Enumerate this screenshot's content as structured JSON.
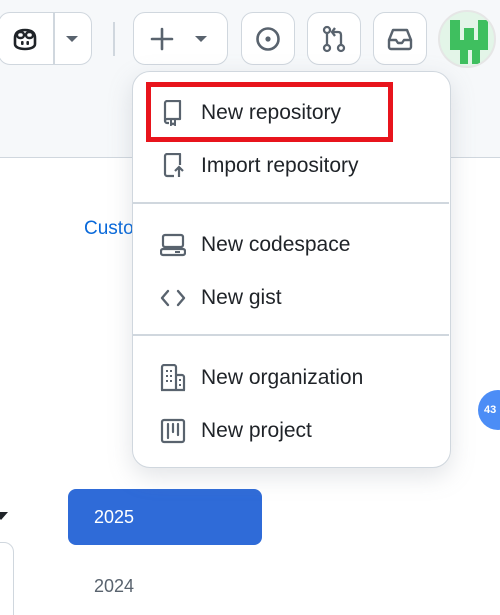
{
  "header": {
    "copilot_icon": "copilot-icon",
    "create_icon": "plus-icon",
    "issues_icon": "issue-opened-icon",
    "pull_requests_icon": "git-pull-request-icon",
    "inbox_icon": "inbox-icon"
  },
  "background": {
    "link_text": "Custo",
    "badge": "43",
    "years": [
      "2025",
      "2024"
    ]
  },
  "create_menu": {
    "items": [
      {
        "label": "New repository",
        "icon": "repo-icon"
      },
      {
        "label": "Import repository",
        "icon": "repo-push-icon"
      },
      {
        "label": "New codespace",
        "icon": "codespaces-icon"
      },
      {
        "label": "New gist",
        "icon": "code-icon"
      },
      {
        "label": "New organization",
        "icon": "organization-icon"
      },
      {
        "label": "New project",
        "icon": "project-icon"
      }
    ]
  },
  "colors": {
    "highlight": "#e8141c",
    "active_year": "#2f6bd8",
    "link": "#0969da"
  }
}
